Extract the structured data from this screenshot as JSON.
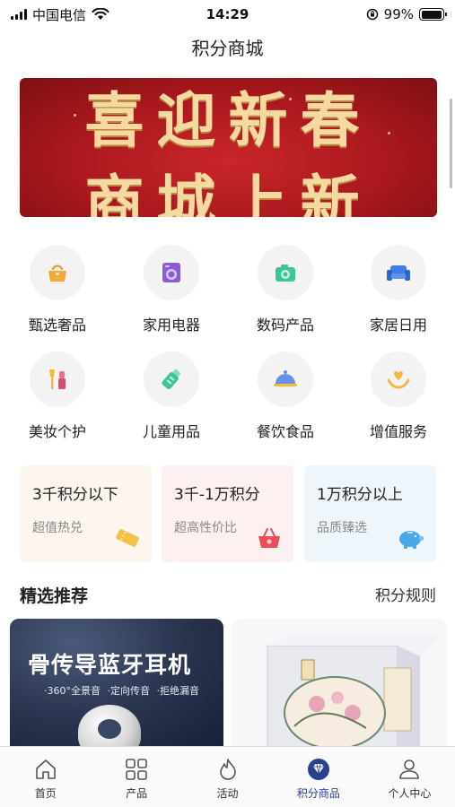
{
  "status_bar": {
    "carrier": "中国电信",
    "time": "14:29",
    "battery": "99%",
    "battery_level": 0.99
  },
  "page": {
    "title": "积分商城"
  },
  "banner": {
    "line1": "喜迎新春",
    "line2": "商城上新"
  },
  "categories": [
    {
      "label": "甄选奢品",
      "icon": "handbag-icon",
      "color": "#f2a93b"
    },
    {
      "label": "家用电器",
      "icon": "washing-machine-icon",
      "color": "#8e5bd6"
    },
    {
      "label": "数码产品",
      "icon": "camera-icon",
      "color": "#3fc49a"
    },
    {
      "label": "家居日用",
      "icon": "sofa-icon",
      "color": "#3d7de6"
    },
    {
      "label": "美妆个护",
      "icon": "makeup-icon",
      "color": "#ef6f8a"
    },
    {
      "label": "儿童用品",
      "icon": "baby-bottle-icon",
      "color": "#3fc49a"
    },
    {
      "label": "餐饮食品",
      "icon": "food-cloche-icon",
      "color": "#6b8fe8"
    },
    {
      "label": "增值服务",
      "icon": "heart-hands-icon",
      "color": "#f3b93a"
    }
  ],
  "points_tiers": [
    {
      "title": "3千积分以下",
      "subtitle": "超值热兑",
      "icon": "ticket-icon",
      "bg": "#fdf6ee",
      "accent": "#f5c04a"
    },
    {
      "title": "3千-1万积分",
      "subtitle": "超高性价比",
      "icon": "basket-icon",
      "bg": "#fdf0f0",
      "accent": "#ec4d5a"
    },
    {
      "title": "1万积分以上",
      "subtitle": "品质臻选",
      "icon": "piggy-bank-icon",
      "bg": "#eef6fb",
      "accent": "#4aa8e8"
    }
  ],
  "section": {
    "title": "精选推荐",
    "link": "积分规则"
  },
  "products": [
    {
      "title": "骨传导蓝牙耳机",
      "subtitle": "·360°全景音 ·定向传音 ·拒绝漏音"
    },
    {
      "label": ""
    }
  ],
  "tabbar": [
    {
      "label": "首页",
      "icon": "home-icon",
      "active": false
    },
    {
      "label": "产品",
      "icon": "grid-icon",
      "active": false
    },
    {
      "label": "活动",
      "icon": "flame-icon",
      "active": false
    },
    {
      "label": "积分商品",
      "icon": "diamond-icon",
      "active": true
    },
    {
      "label": "个人中心",
      "icon": "user-icon",
      "active": false
    }
  ],
  "colors": {
    "accent": "#2b3f8f",
    "banner_red": "#b11c21",
    "banner_gold": "#f6d9a0"
  }
}
